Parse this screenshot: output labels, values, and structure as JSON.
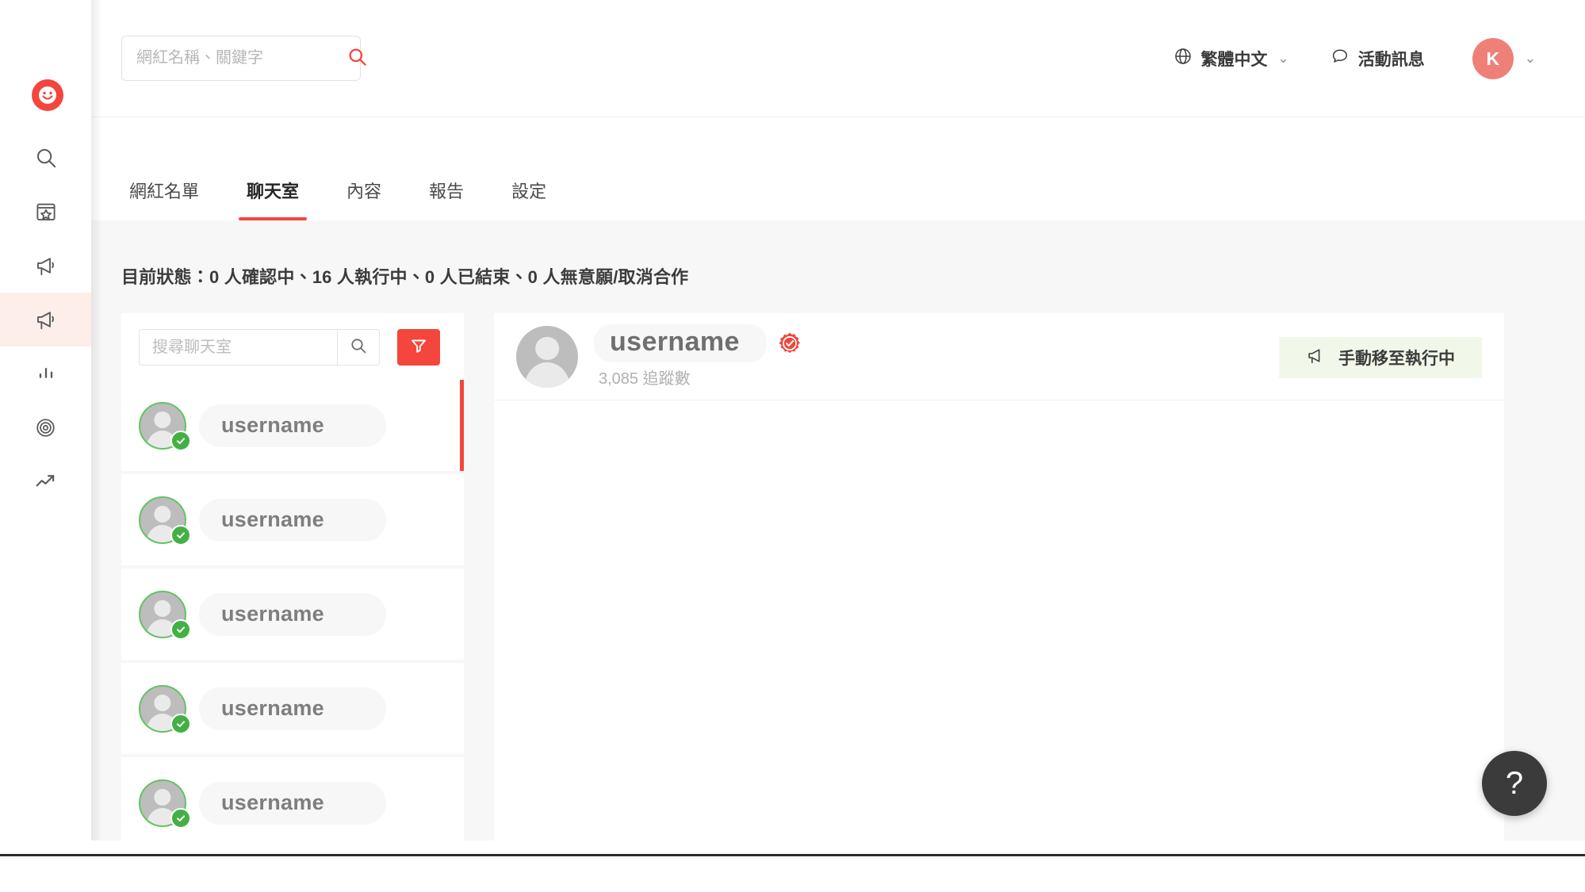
{
  "brand": {
    "logo_icon": "smiley-logo-icon",
    "accent_color": "#f4463c",
    "active_rail_bg": "#fdeeea"
  },
  "rail": {
    "items": [
      {
        "icon": "search-icon",
        "name": "rail-item-search",
        "active": false
      },
      {
        "icon": "star-box-icon",
        "name": "rail-item-favorites",
        "active": false
      },
      {
        "icon": "megaphone-icon",
        "name": "rail-item-campaigns",
        "active": false
      },
      {
        "icon": "megaphone-icon",
        "name": "rail-item-campaign-active",
        "active": true
      },
      {
        "icon": "bar-chart-icon",
        "name": "rail-item-analytics",
        "active": false
      },
      {
        "icon": "target-icon",
        "name": "rail-item-target",
        "active": false
      },
      {
        "icon": "trending-up-icon",
        "name": "rail-item-trending",
        "active": false
      }
    ]
  },
  "header": {
    "search": {
      "placeholder": "網紅名稱、關鍵字",
      "value": "",
      "icon": "search-icon"
    },
    "language": {
      "icon": "globe-icon",
      "label": "繁體中文",
      "chevron": "⌄"
    },
    "messages": {
      "icon": "speech-bubble-icon",
      "label": "活動訊息"
    },
    "account": {
      "initial": "K",
      "chevron": "⌄",
      "color": "#ee8078"
    }
  },
  "tabs": [
    {
      "label": "網紅名單",
      "active": false
    },
    {
      "label": "聊天室",
      "active": true
    },
    {
      "label": "內容",
      "active": false
    },
    {
      "label": "報告",
      "active": false
    },
    {
      "label": "設定",
      "active": false
    }
  ],
  "status": {
    "text": "目前狀態：0 人確認中、16 人執行中、0 人已結束、0 人無意願/取消合作"
  },
  "chat_list": {
    "search": {
      "placeholder": "搜尋聊天室",
      "value": "",
      "search_icon": "search-icon"
    },
    "filter_button": {
      "icon": "funnel-filter-icon",
      "color": "#f4463c"
    },
    "items": [
      {
        "name": "username",
        "verified": true,
        "selected": true
      },
      {
        "name": "username",
        "verified": true,
        "selected": false
      },
      {
        "name": "username",
        "verified": true,
        "selected": false
      },
      {
        "name": "username",
        "verified": true,
        "selected": false
      },
      {
        "name": "username",
        "verified": true,
        "selected": false
      }
    ]
  },
  "chat_panel": {
    "profile": {
      "name": "username",
      "verified_icon": "verified-badge-icon",
      "followers": "3,085 追蹤數"
    },
    "action": {
      "icon": "megaphone-icon",
      "label": "手動移至執行中",
      "background": "#f1f8ea"
    }
  },
  "help": {
    "label": "?"
  }
}
